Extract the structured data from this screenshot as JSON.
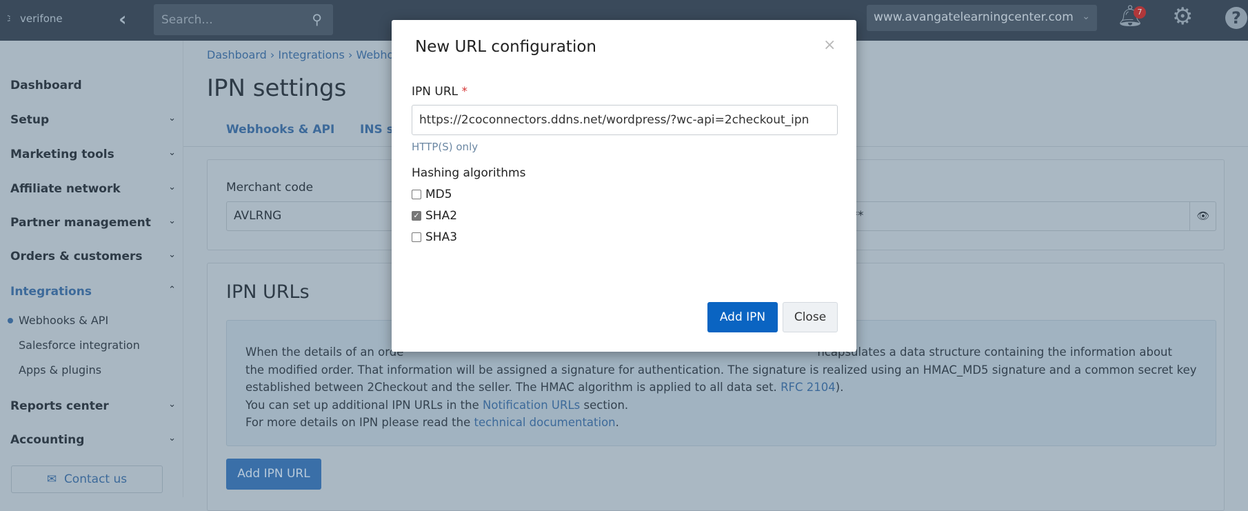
{
  "header": {
    "logo": "verifone",
    "search_placeholder": "Search...",
    "domain": "www.avangatelearningcenter.com",
    "notifications_count": "7"
  },
  "sidebar": {
    "items": [
      {
        "label": "Dashboard"
      },
      {
        "label": "Setup"
      },
      {
        "label": "Marketing tools"
      },
      {
        "label": "Affiliate network"
      },
      {
        "label": "Partner management"
      },
      {
        "label": "Orders & customers"
      },
      {
        "label": "Integrations",
        "expanded": true
      }
    ],
    "subitems": [
      {
        "label": "Webhooks & API",
        "active": true
      },
      {
        "label": "Salesforce integration"
      },
      {
        "label": "Apps & plugins"
      }
    ],
    "items_after": [
      {
        "label": "Reports center"
      },
      {
        "label": "Accounting"
      }
    ],
    "contact": "Contact us"
  },
  "breadcrumb": {
    "text": "Dashboard › Integrations › Webho"
  },
  "page": {
    "title": "IPN settings",
    "tabs": [
      "Webhooks & API",
      "INS se"
    ]
  },
  "merchant": {
    "label": "Merchant code",
    "value": "AVLRNG",
    "secret_masked": "*****"
  },
  "ipn": {
    "title": "IPN URLs",
    "line1a": "When the details of an orde",
    "line1b": "ncapsulates a data structure containing the information about",
    "line2": "the modified order. That information will be assigned a signature for authentication. The signature is realized using an HMAC_MD5 signature and a common secret key",
    "line3": "established between 2Checkout and the seller. The HMAC algorithm is applied to all data set. ",
    "rfc_link": "RFC 2104",
    "line3end": ").",
    "line4": "You can set up additional IPN URLs in the ",
    "notif_link": "Notification URLs",
    "line4end": " section.",
    "line5": "For more details on IPN please read the ",
    "doc_link": "technical documentation",
    "line5end": ".",
    "add_button": "Add IPN URL"
  },
  "modal": {
    "title": "New URL configuration",
    "close_x": "×",
    "url_label": "IPN URL",
    "required": "*",
    "url_value": "https://2coconnectors.ddns.net/wordpress/?wc-api=2checkout_ipn",
    "help": "HTTP(S) only",
    "hash_label": "Hashing algorithms",
    "algorithms": [
      {
        "label": "MD5",
        "checked": false
      },
      {
        "label": "SHA2",
        "checked": true
      },
      {
        "label": "SHA3",
        "checked": false
      }
    ],
    "add_button": "Add IPN",
    "close_button": "Close"
  },
  "colors": {
    "primary": "#0a64c2",
    "required": "#d43535",
    "badge": "#b0373a"
  }
}
